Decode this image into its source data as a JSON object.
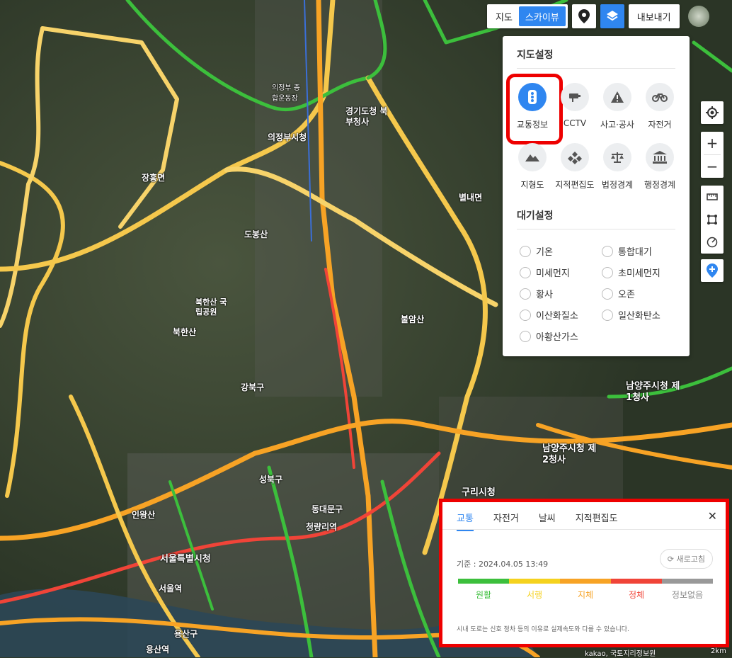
{
  "topbar": {
    "map_label": "지도",
    "skyview_label": "스카이뷰",
    "export_label": "내보내기"
  },
  "map_settings": {
    "title": "지도설정",
    "layers": [
      {
        "label": "교통정보",
        "icon": "traffic-light-icon",
        "selected": true
      },
      {
        "label": "CCTV",
        "icon": "cctv-icon",
        "selected": false
      },
      {
        "label": "사고·공사",
        "icon": "warning-icon",
        "selected": false
      },
      {
        "label": "자전거",
        "icon": "bicycle-icon",
        "selected": false
      },
      {
        "label": "지형도",
        "icon": "mountain-icon",
        "selected": false
      },
      {
        "label": "지적편집도",
        "icon": "cadastral-icon",
        "selected": false
      },
      {
        "label": "법정경계",
        "icon": "scales-icon",
        "selected": false
      },
      {
        "label": "행정경계",
        "icon": "building-icon",
        "selected": false
      }
    ]
  },
  "air_settings": {
    "title": "대기설정",
    "options": [
      "기온",
      "통합대기",
      "미세먼지",
      "초미세먼지",
      "황사",
      "오존",
      "이산화질소",
      "일산화탄소",
      "아황산가스"
    ]
  },
  "legend": {
    "tabs": [
      "교통",
      "자전거",
      "날씨",
      "지적편집도"
    ],
    "active_tab": "교통",
    "basis": "기준 : 2024.04.05 13:49",
    "refresh_label": "새로고침",
    "levels": [
      {
        "label": "원활",
        "color": "#3cbf3c"
      },
      {
        "label": "서행",
        "color": "#f5d21e"
      },
      {
        "label": "지체",
        "color": "#f7a325"
      },
      {
        "label": "정체",
        "color": "#f04438"
      },
      {
        "label": "정보없음",
        "color": "#999999"
      }
    ],
    "notice": "시내 도로는 신호 정차 등의 이유로 실제속도와 다를 수 있습니다."
  },
  "map_labels": [
    "의정부시청",
    "경기도청 북부청사",
    "장흥면",
    "도봉산",
    "북한산 국립공원",
    "북한산",
    "불암산",
    "남양주시청 제1청사",
    "남양주시청 제2청사",
    "구리시청",
    "서울특별시청",
    "서울역",
    "용산구",
    "성북구",
    "강북구",
    "동대문구",
    "청량리역",
    "인왕산",
    "별내면",
    "의정부 종합운동장",
    "용산역"
  ],
  "footer": {
    "copyright": "kakao, 국토지리정보원",
    "scale": "2km"
  }
}
